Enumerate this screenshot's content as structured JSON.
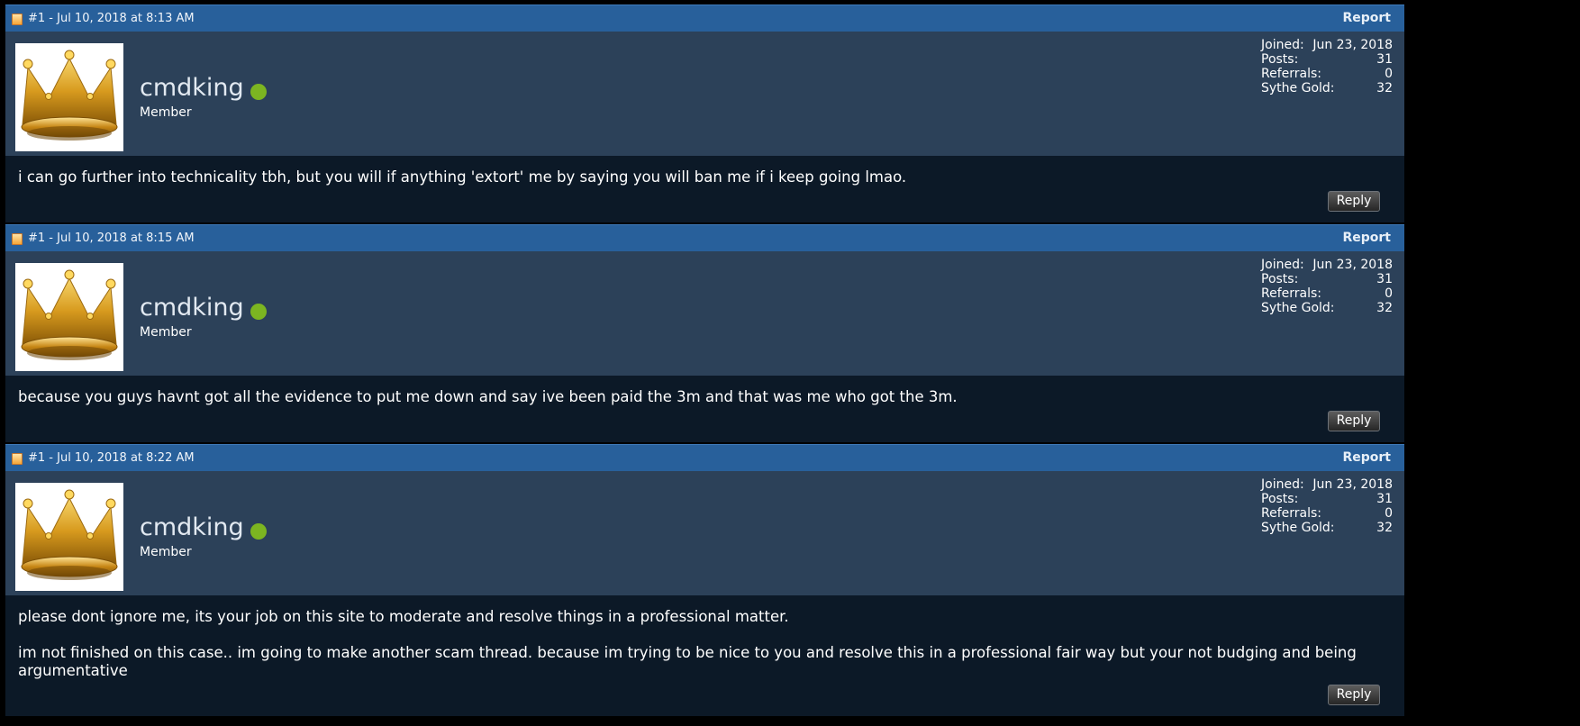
{
  "posts": [
    {
      "header": {
        "date": "#1 - Jul 10, 2018 at 8:13 AM",
        "report_label": "Report"
      },
      "user": {
        "name": "cmdking",
        "title": "Member",
        "avatar": "crown-avatar"
      },
      "stats": [
        {
          "label": "Joined:",
          "value": "Jun 23, 2018"
        },
        {
          "label": "Posts:",
          "value": "31"
        },
        {
          "label": "Referrals:",
          "value": "0"
        },
        {
          "label": "Sythe Gold:",
          "value": "32"
        }
      ],
      "message": [
        "i can go further into technicality tbh, but you will if anything 'extort' me by saying you will ban me if i keep going lmao."
      ],
      "reply_label": "Reply"
    },
    {
      "header": {
        "date": "#1 - Jul 10, 2018 at 8:15 AM",
        "report_label": "Report"
      },
      "user": {
        "name": "cmdking",
        "title": "Member",
        "avatar": "crown-avatar"
      },
      "stats": [
        {
          "label": "Joined:",
          "value": "Jun 23, 2018"
        },
        {
          "label": "Posts:",
          "value": "31"
        },
        {
          "label": "Referrals:",
          "value": "0"
        },
        {
          "label": "Sythe Gold:",
          "value": "32"
        }
      ],
      "message": [
        "because you guys havnt got all the evidence to put me down and say ive been paid the 3m and that was me who got the 3m."
      ],
      "reply_label": "Reply"
    },
    {
      "header": {
        "date": "#1 - Jul 10, 2018 at 8:22 AM",
        "report_label": "Report"
      },
      "user": {
        "name": "cmdking",
        "title": "Member",
        "avatar": "crown-avatar"
      },
      "stats": [
        {
          "label": "Joined:",
          "value": "Jun 23, 2018"
        },
        {
          "label": "Posts:",
          "value": "31"
        },
        {
          "label": "Referrals:",
          "value": "0"
        },
        {
          "label": "Sythe Gold:",
          "value": "32"
        }
      ],
      "message": [
        "please dont ignore me, its your job on this site to moderate and resolve things in a professional matter.",
        "im not finished on this case.. im going to make another scam thread. because im trying to be nice to you and resolve this in a professional fair way but your not budging and being argumentative"
      ],
      "reply_label": "Reply"
    }
  ],
  "colors": {
    "header": "#28609b",
    "user_panel": "#2c4159",
    "body": "#0c1927",
    "online": "#7cb521"
  }
}
